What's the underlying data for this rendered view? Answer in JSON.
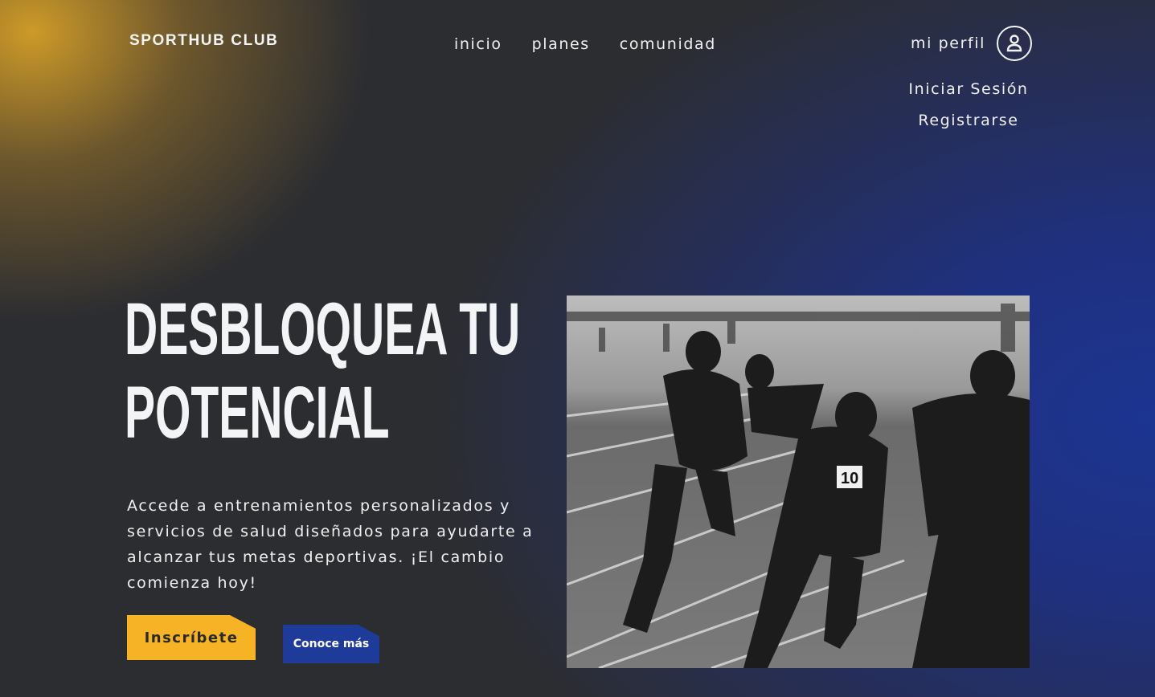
{
  "header": {
    "brand": "SPORTHUB CLUB",
    "nav": [
      "inicio",
      "planes",
      "comunidad"
    ],
    "profile_label": "mi perfil",
    "profile_icon": "user-circle-icon",
    "login": "Iniciar Sesión",
    "register": "Registrarse"
  },
  "hero": {
    "title_line1": "DESBLOQUEA TU",
    "title_line2": "POTENCIAL",
    "description": "Accede a entrenamientos personalizados y servicios de salud diseñados para ayudarte a alcanzar tus metas deportivas. ¡El cambio comienza hoy!",
    "primary_cta": "Inscríbete",
    "secondary_cta": "Conoce más",
    "image_alt": "Atletas corriendo en una pista"
  },
  "colors": {
    "accent_yellow": "#f5b325",
    "accent_blue": "#1f3b9a",
    "background_dark": "#2c2d31"
  }
}
